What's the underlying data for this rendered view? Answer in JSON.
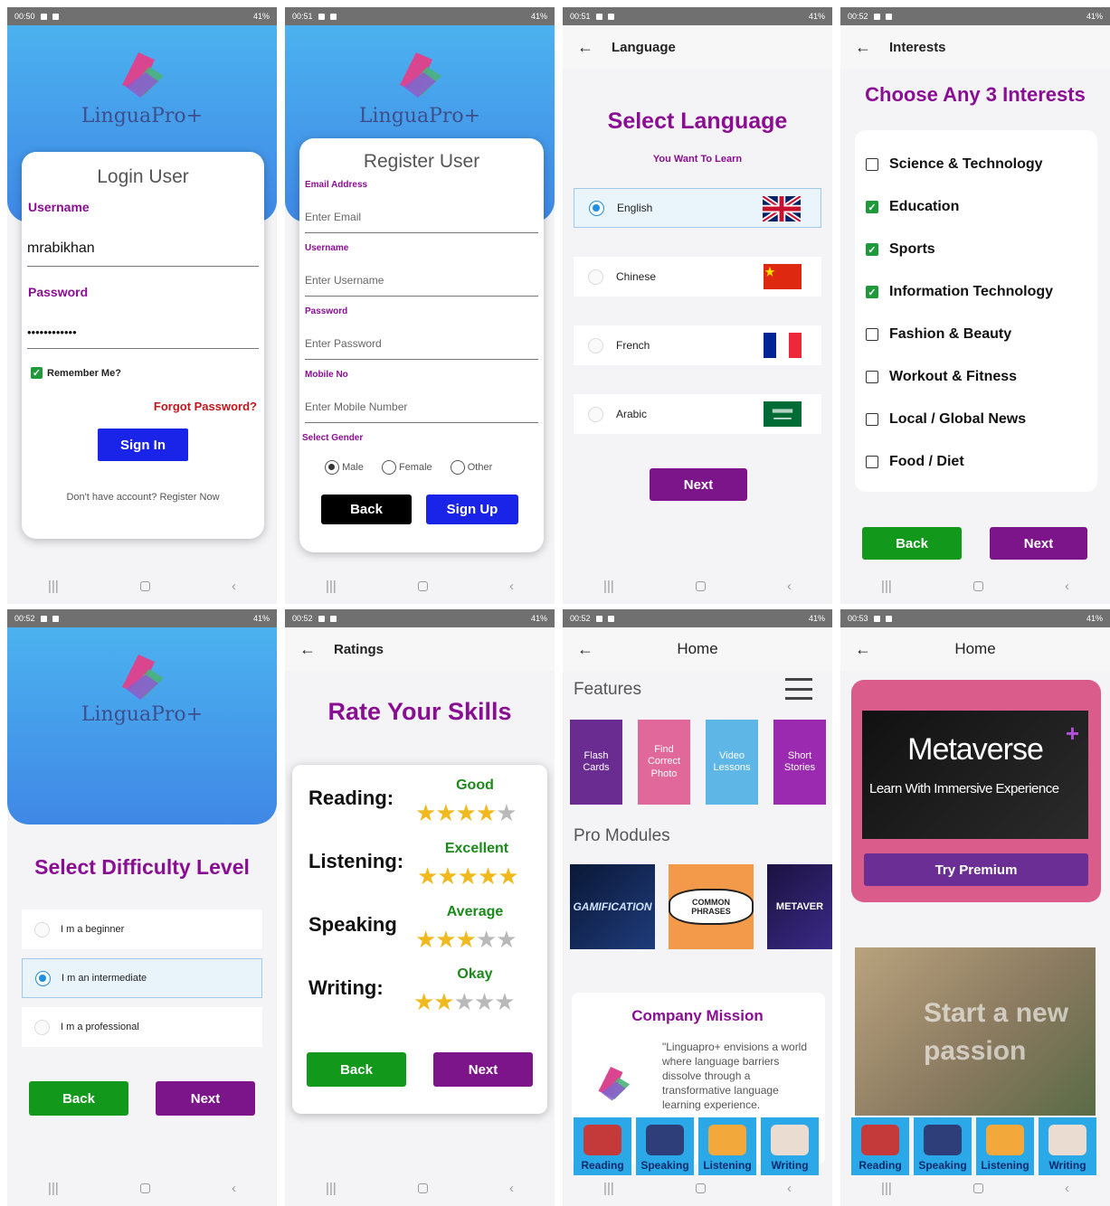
{
  "brand": "LinguaPro+",
  "statusbars": {
    "p1": {
      "time": "00:50",
      "batt": "41%"
    },
    "p2": {
      "time": "00:51",
      "batt": "41%"
    },
    "p3": {
      "time": "00:51",
      "batt": "41%"
    },
    "p4": {
      "time": "00:52",
      "batt": "41%"
    },
    "p5": {
      "time": "00:52",
      "batt": "41%"
    },
    "p6": {
      "time": "00:52",
      "batt": "41%"
    },
    "p7": {
      "time": "00:52",
      "batt": "41%"
    },
    "p8": {
      "time": "00:53",
      "batt": "41%"
    }
  },
  "login": {
    "title": "Login User",
    "username_label": "Username",
    "username_value": "mrabikhan",
    "password_label": "Password",
    "password_value": "••••••••••••",
    "remember": "Remember Me?",
    "forgot": "Forgot Password?",
    "signin": "Sign In",
    "register": "Don't have account? Register Now"
  },
  "register": {
    "title": "Register User",
    "email_label": "Email Address",
    "email_ph": "Enter Email",
    "user_label": "Username",
    "user_ph": "Enter Username",
    "pass_label": "Password",
    "pass_ph": "Enter Password",
    "mobile_label": "Mobile No",
    "mobile_ph": "Enter Mobile Number",
    "gender_label": "Select Gender",
    "genders": [
      "Male",
      "Female",
      "Other"
    ],
    "back": "Back",
    "signup": "Sign Up"
  },
  "language": {
    "topbar": "Language",
    "title": "Select Language",
    "subtitle": "You Want To Learn",
    "options": [
      "English",
      "Chinese",
      "French",
      "Arabic"
    ],
    "next": "Next"
  },
  "interests": {
    "topbar": "Interests",
    "title": "Choose Any 3 Interests",
    "items": [
      {
        "label": "Science & Technology",
        "checked": false
      },
      {
        "label": "Education",
        "checked": true
      },
      {
        "label": "Sports",
        "checked": true
      },
      {
        "label": "Information Technology",
        "checked": true
      },
      {
        "label": "Fashion & Beauty",
        "checked": false
      },
      {
        "label": "Workout & Fitness",
        "checked": false
      },
      {
        "label": "Local / Global News",
        "checked": false
      },
      {
        "label": "Food / Diet",
        "checked": false
      }
    ],
    "back": "Back",
    "next": "Next"
  },
  "difficulty": {
    "title": "Select Difficulty Level",
    "options": [
      "I m a beginner",
      "I m an intermediate",
      "I m a professional"
    ],
    "back": "Back",
    "next": "Next"
  },
  "ratings": {
    "topbar": "Ratings",
    "title": "Rate Your Skills",
    "skills": [
      {
        "name": "Reading:",
        "level": "Good",
        "stars": 4
      },
      {
        "name": "Listening:",
        "level": "Excellent",
        "stars": 5
      },
      {
        "name": "Speaking",
        "level": "Average",
        "stars": 3
      },
      {
        "name": "Writing:",
        "level": "Okay",
        "stars": 2
      }
    ],
    "back": "Back",
    "next": "Next"
  },
  "home1": {
    "topbar": "Home",
    "features_label": "Features",
    "features": [
      {
        "label": "Flash Cards",
        "color": "#6b2c91"
      },
      {
        "label": "Find Correct Photo",
        "color": "#e0689a"
      },
      {
        "label": "Video Lessons",
        "color": "#5db6e6"
      },
      {
        "label": "Short Stories",
        "color": "#9b2ab0"
      }
    ],
    "pro_label": "Pro Modules",
    "modules": [
      "GAMIFICATION",
      "COMMON PHRASES",
      "METAVER"
    ],
    "mission_title": "Company Mission",
    "mission_text": "\"Linguapro+ envisions a world where language barriers dissolve through a transformative language learning experience."
  },
  "home2": {
    "topbar": "Home",
    "promo_title": "Metaverse",
    "promo_sub": "Learn With Immersive Experience",
    "premium": "Try Premium",
    "banner": "Start a new passion"
  },
  "bottom_tabs": [
    "Reading",
    "Speaking",
    "Listening",
    "Writing"
  ]
}
